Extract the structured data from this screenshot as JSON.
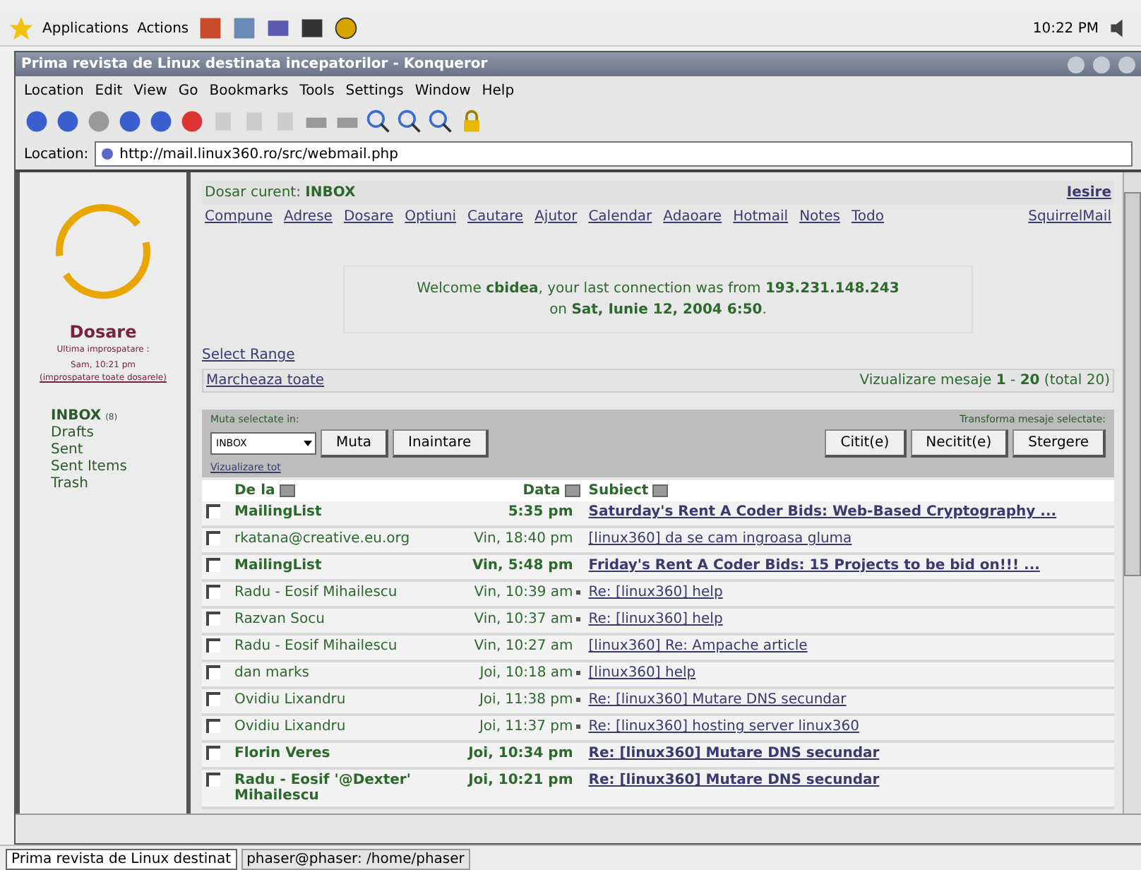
{
  "panel": {
    "menus": [
      "Applications",
      "Actions"
    ],
    "clock": "10:22 PM"
  },
  "window": {
    "title": "Prima revista de Linux destinata incepatorilor - Konqueror"
  },
  "menu_bar": [
    "Location",
    "Edit",
    "View",
    "Go",
    "Bookmarks",
    "Tools",
    "Settings",
    "Window",
    "Help"
  ],
  "location": {
    "label": "Location:",
    "url": "http://mail.linux360.ro/src/webmail.php"
  },
  "sidebar": {
    "title": "Dosare",
    "refresh_label": "Ultima improspatare :",
    "refresh_time": "Sam, 10:21 pm",
    "refresh_link": "(improspatare toate dosarele)",
    "folders": [
      {
        "name": "INBOX",
        "count": "(8)",
        "unread": true
      },
      {
        "name": "Drafts",
        "unread": false
      },
      {
        "name": "Sent",
        "unread": false
      },
      {
        "name": "Sent Items",
        "unread": false
      },
      {
        "name": "Trash",
        "unread": false
      }
    ]
  },
  "header": {
    "current_label": "Dosar curent:",
    "current_folder": "INBOX",
    "logout": "Iesire"
  },
  "nav_links": [
    "Compune",
    "Adrese",
    "Dosare",
    "Optiuni",
    "Cautare",
    "Ajutor",
    "Calendar",
    "Adaoare",
    "Hotmail",
    "Notes",
    "Todo"
  ],
  "brand_link": "SquirrelMail",
  "welcome": [
    "Welcome **cbidea**, your last connection was from **193.231.148.243**",
    "on **Sat, Iunie 12, 2004 6:50**."
  ],
  "select_range": "Select Range",
  "mark_all": "Marcheaza toate",
  "view_info": "Vizualizare mesaje **1** - **20** (total 20)",
  "actions": {
    "move_label": "Muta selectate in:",
    "folder": "INBOX",
    "move_buttons": [
      "Muta",
      "Inaintare"
    ],
    "transform_label": "Transforma mesaje selectate:",
    "transform_buttons": [
      "Citit(e)",
      "Necitit(e)",
      "Stergere"
    ],
    "view_all": "Vizualizare tot"
  },
  "columns": [
    "De la",
    "Data",
    "Subiect"
  ],
  "rows": [
    {
      "from": "MailingList",
      "date": "5:35 pm",
      "subject": "Saturday's Rent A Coder Bids: Web-Based Cryptography ...",
      "unread": true,
      "answered": false,
      "checked": false
    },
    {
      "from": "rkatana@creative.eu.org",
      "date": "Vin, 18:40 pm",
      "subject": "[linux360] da se cam ingroasa gluma",
      "unread": false,
      "answered": false,
      "checked": false
    },
    {
      "from": "MailingList",
      "date": "Vin, 5:48 pm",
      "subject": "Friday's Rent A Coder Bids: 15 Projects to be bid on!!! ...",
      "unread": true,
      "answered": false,
      "checked": false
    },
    {
      "from": "Radu - Eosif Mihailescu",
      "date": "Vin, 10:39 am",
      "subject": "Re: [linux360] help",
      "unread": false,
      "answered": true,
      "checked": false
    },
    {
      "from": "Razvan Socu",
      "date": "Vin, 10:37 am",
      "subject": "Re: [linux360] help",
      "unread": false,
      "answered": true,
      "checked": false
    },
    {
      "from": "Radu - Eosif Mihailescu",
      "date": "Vin, 10:27 am",
      "subject": "[linux360] Re: Ampache article",
      "unread": false,
      "answered": false,
      "checked": false
    },
    {
      "from": "dan marks",
      "date": "Joi, 10:18 am",
      "subject": "[linux360] help",
      "unread": false,
      "answered": true,
      "checked": false
    },
    {
      "from": "Ovidiu Lixandru",
      "date": "Joi, 11:38 pm",
      "subject": "Re: [linux360] Mutare DNS secundar",
      "unread": false,
      "answered": true,
      "checked": false
    },
    {
      "from": "Ovidiu Lixandru",
      "date": "Joi, 11:37 pm",
      "subject": "Re: [linux360] hosting server linux360",
      "unread": false,
      "answered": true,
      "checked": false
    },
    {
      "from": "Florin Veres",
      "date": "Joi, 10:34 pm",
      "subject": "Re: [linux360] Mutare DNS secundar",
      "unread": true,
      "answered": false,
      "checked": false
    },
    {
      "from": "Radu - Eosif '@Dexter' Mihailescu",
      "date": "Joi, 10:21 pm",
      "subject": "Re: [linux360] Mutare DNS secundar",
      "unread": true,
      "answered": false,
      "checked": false
    }
  ],
  "taskbar": [
    {
      "label": "Prima revista de Linux destinat",
      "selected": true
    },
    {
      "label": "phaser@phaser: /home/phaser",
      "selected": false
    }
  ]
}
